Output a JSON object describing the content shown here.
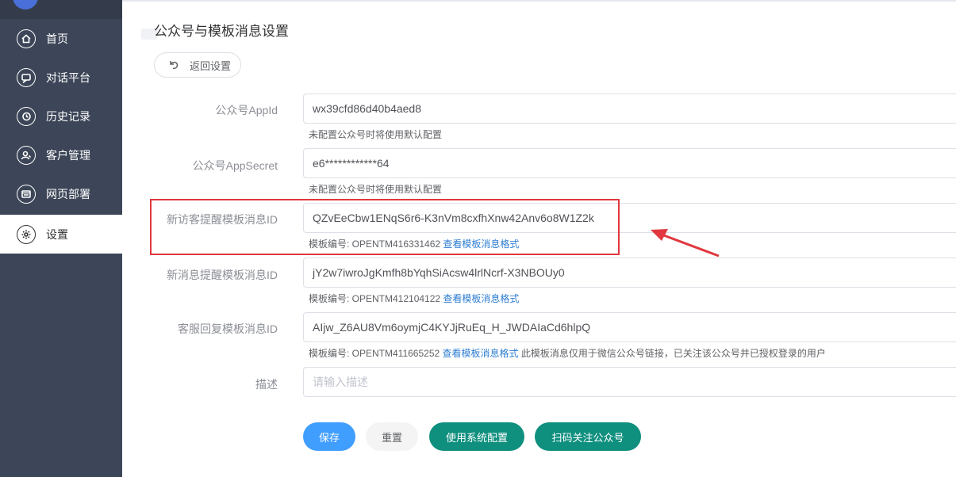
{
  "sidebar": {
    "items": [
      {
        "label": "首页",
        "icon": "home-icon"
      },
      {
        "label": "对话平台",
        "icon": "chat-icon"
      },
      {
        "label": "历史记录",
        "icon": "history-icon"
      },
      {
        "label": "客户管理",
        "icon": "customer-icon"
      },
      {
        "label": "网页部署",
        "icon": "web-deploy-icon"
      },
      {
        "label": "设置",
        "icon": "settings-icon",
        "active": true
      }
    ]
  },
  "page": {
    "title": "公众号与模板消息设置",
    "back_label": "返回设置"
  },
  "form": {
    "appid": {
      "label": "公众号AppId",
      "value": "wx39cfd86d40b4aed8",
      "hint": "未配置公众号时将使用默认配置"
    },
    "appsecret": {
      "label": "公众号AppSecret",
      "value": "e6************64",
      "hint": "未配置公众号时将使用默认配置"
    },
    "new_visitor": {
      "label": "新访客提醒模板消息ID",
      "value": "QZvEeCbw1ENqS6r6-K3nVm8cxfhXnw42Anv6o8W1Z2k",
      "hint_prefix": "模板编号: OPENTM416331462",
      "hint_link": "查看模板消息格式"
    },
    "new_message": {
      "label": "新消息提醒模板消息ID",
      "value": "jY2w7iwroJgKmfh8bYqhSiAcsw4lrlNcrf-X3NBOUy0",
      "hint_prefix": "模板编号: OPENTM412104122",
      "hint_link": "查看模板消息格式"
    },
    "service_reply": {
      "label": "客服回复模板消息ID",
      "value": "AIjw_Z6AU8Vm6oymjC4KYJjRuEq_H_JWDAIaCd6hlpQ",
      "hint_prefix": "模板编号: OPENTM411665252",
      "hint_link": "查看模板消息格式",
      "hint_suffix": "此模板消息仅用于微信公众号链接，已关注该公众号并已授权登录的用户"
    },
    "description": {
      "label": "描述",
      "placeholder": "请输入描述"
    }
  },
  "buttons": {
    "save": "保存",
    "reset": "重置",
    "use_system": "使用系统配置",
    "scan_follow": "扫码关注公众号"
  },
  "colors": {
    "sidebar_bg": "#3d4658",
    "primary": "#409eff",
    "teal": "#0f8f7e",
    "highlight_red": "#e0383e",
    "link": "#2d7dd2"
  }
}
